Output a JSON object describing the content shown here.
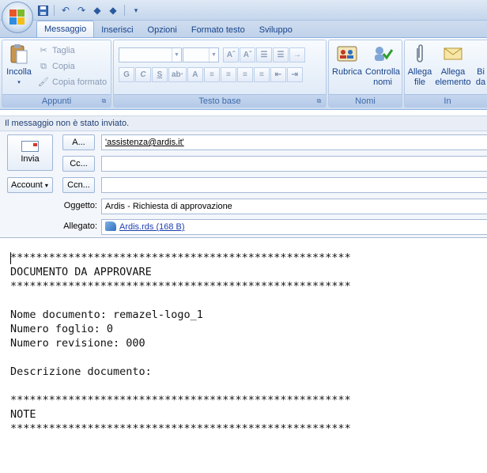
{
  "qat": {
    "icons": [
      "save-icon",
      "undo-icon",
      "redo-icon",
      "up-arrow-icon",
      "down-arrow-icon",
      "customize-icon"
    ]
  },
  "tabs": [
    "Messaggio",
    "Inserisci",
    "Opzioni",
    "Formato testo",
    "Sviluppo"
  ],
  "ribbon": {
    "appunti": {
      "paste_label": "Incolla",
      "cut_label": "Taglia",
      "copy_label": "Copia",
      "format_painter_label": "Copia formato",
      "group_label": "Appunti"
    },
    "testo_base": {
      "group_label": "Testo base",
      "buttons_row1": [
        "Aˆ",
        "Aˇ",
        "☰",
        "☰",
        "→"
      ],
      "buttons_row2": [
        "G",
        "C",
        "S",
        "ab‧",
        "A",
        "≡",
        "≡",
        "≡",
        "≡",
        "⇤",
        "⇥"
      ]
    },
    "nomi": {
      "rubrica_label": "Rubrica",
      "controlla_label_1": "Controlla",
      "controlla_label_2": "nomi",
      "group_label": "Nomi"
    },
    "includi": {
      "allega_file_1": "Allega",
      "allega_file_2": "file",
      "allega_elem_1": "Allega",
      "allega_elem_2": "elemento",
      "bi_1": "Bi",
      "bi_2": "da",
      "group_label": "In"
    }
  },
  "infobar": {
    "text": "Il messaggio non è stato inviato."
  },
  "header": {
    "send_label": "Invia",
    "account_label": "Account",
    "to_button": "A...",
    "cc_button": "Cc...",
    "ccn_button": "Ccn...",
    "to_value": "'assistenza@ardis.it'",
    "cc_value": "",
    "ccn_value": "",
    "subject_label": "Oggetto:",
    "subject_value": "Ardis - Richiesta di approvazione",
    "attachment_label": "Allegato:",
    "attachment_value": "Ardis.rds (168 B)"
  },
  "body": {
    "text": "*****************************************************\nDOCUMENTO DA APPROVARE\n*****************************************************\n\nNome documento: remazel-logo_1\nNumero foglio: 0\nNumero revisione: 000\n\nDescrizione documento:\n\n*****************************************************\nNOTE\n*****************************************************"
  }
}
